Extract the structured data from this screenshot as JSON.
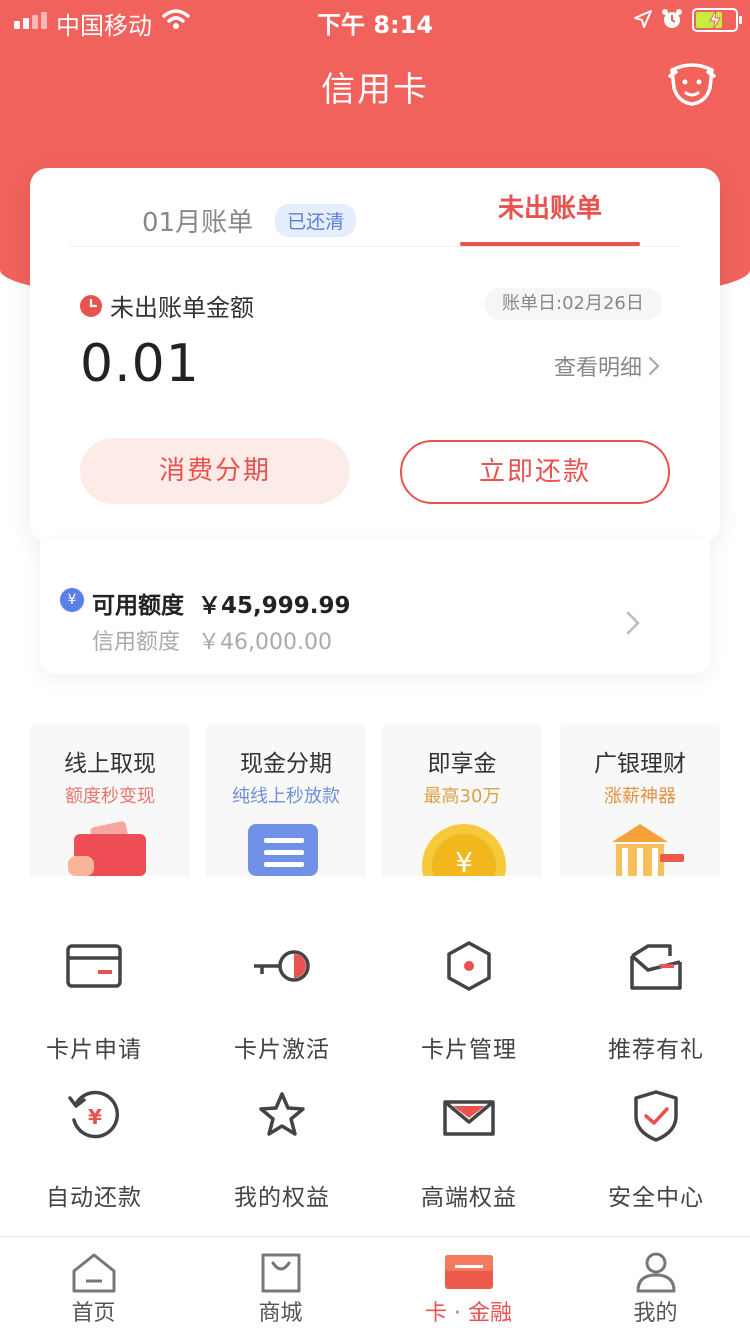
{
  "status_bar": {
    "carrier": "中国移动",
    "time": "下午 8:14"
  },
  "nav": {
    "title": "信用卡"
  },
  "bill": {
    "tab_last": "01月账单",
    "tab_last_badge": "已还清",
    "tab_current": "未出账单",
    "unbilled_label": "未出账单金额",
    "due_date": "账单日:02月26日",
    "amount": "0.01",
    "view_detail": "查看明细",
    "btn_installment": "消费分期",
    "btn_repay": "立即还款"
  },
  "quota": {
    "available_label": "可用额度",
    "available_value": "￥45,999.99",
    "credit_label": "信用额度",
    "credit_value": "￥46,000.00"
  },
  "promos": [
    {
      "title": "线上取现",
      "subtitle": "额度秒变现",
      "sub_color": "#e8766f"
    },
    {
      "title": "现金分期",
      "subtitle": "纯线上秒放款",
      "sub_color": "#6f8fd8"
    },
    {
      "title": "即享金",
      "subtitle": "最高30万",
      "sub_color": "#d9a346"
    },
    {
      "title": "广银理财",
      "subtitle": "涨薪神器",
      "sub_color": "#e2923f"
    }
  ],
  "services": [
    {
      "label": "卡片申请",
      "icon": "card-icon"
    },
    {
      "label": "卡片激活",
      "icon": "key-icon"
    },
    {
      "label": "卡片管理",
      "icon": "hexagon-icon"
    },
    {
      "label": "推荐有礼",
      "icon": "gift-card-icon"
    },
    {
      "label": "自动还款",
      "icon": "auto-repay-icon"
    },
    {
      "label": "我的权益",
      "icon": "star-icon"
    },
    {
      "label": "高端权益",
      "icon": "envelope-icon"
    },
    {
      "label": "安全中心",
      "icon": "shield-icon"
    }
  ],
  "tabbar": {
    "home": "首页",
    "mall": "商城",
    "card_finance": "卡 · 金融",
    "mine": "我的"
  },
  "colors": {
    "brand_red": "#f1625c",
    "accent_red": "#e8524f",
    "badge_blue": "#5d7fe0"
  }
}
